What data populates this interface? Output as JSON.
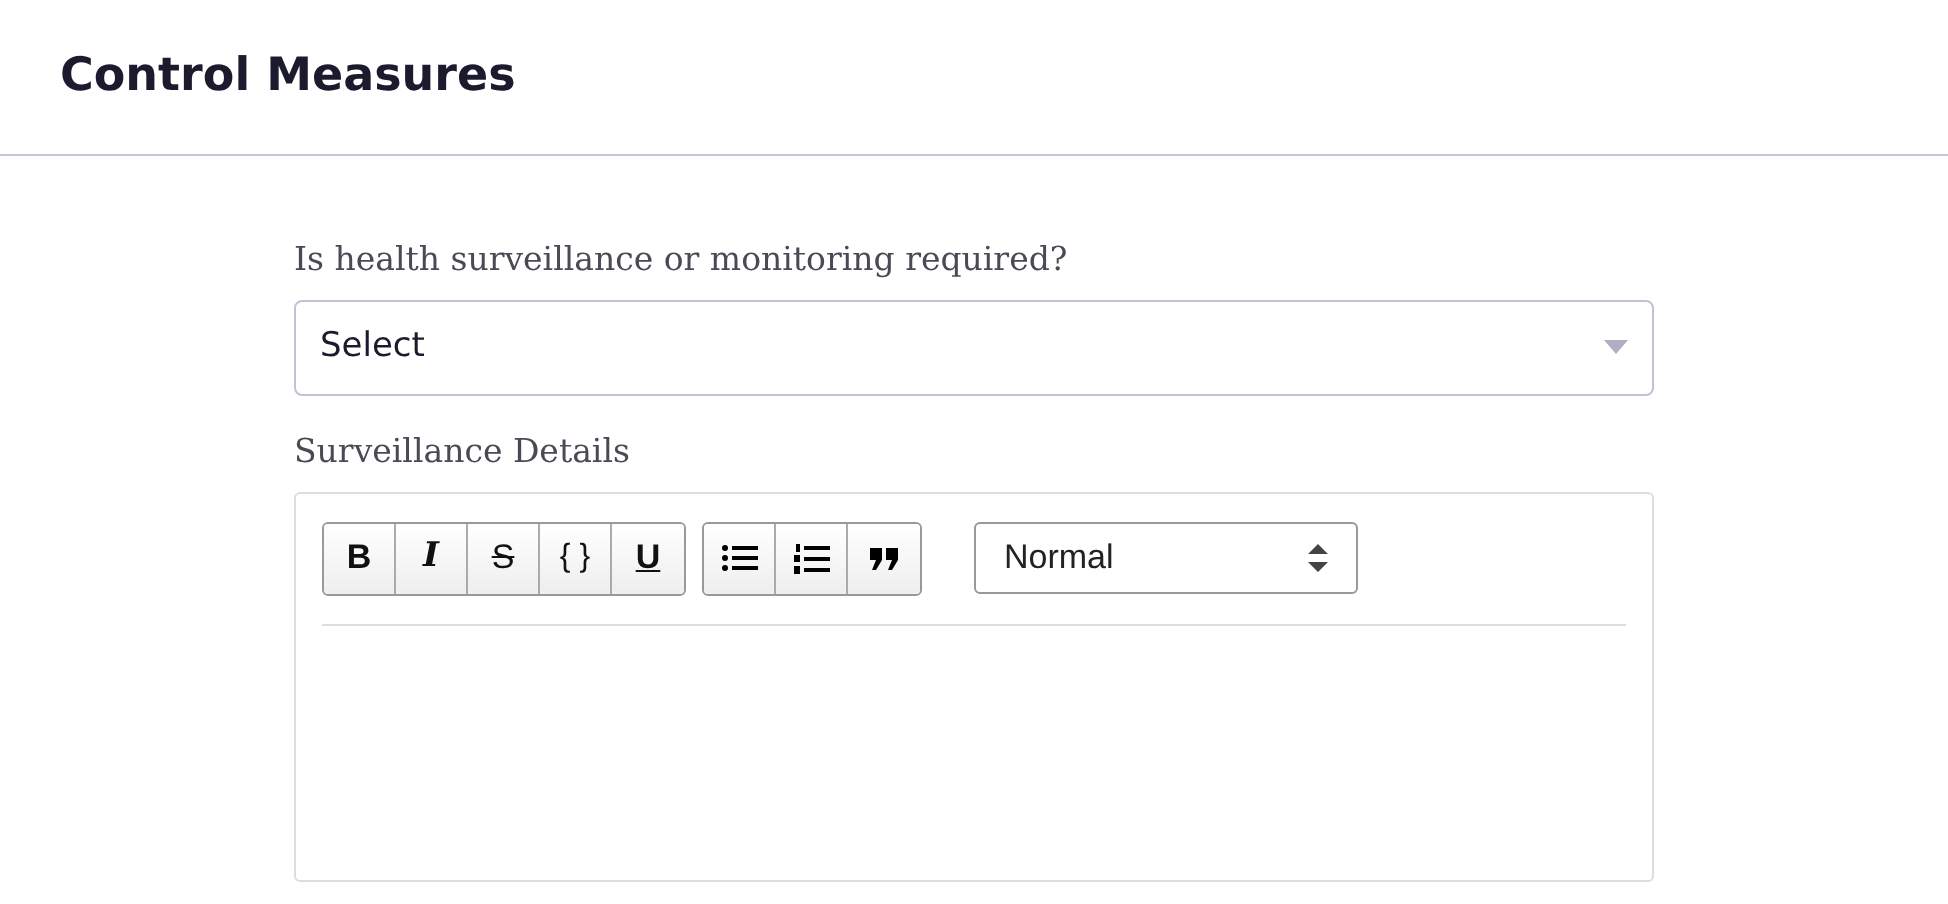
{
  "header": {
    "title": "Control Measures"
  },
  "fields": [
    {
      "kind": "select",
      "label": "Is health surveillance or monitoring required?",
      "value": "Select"
    },
    {
      "kind": "editor",
      "label": "Surveillance Details",
      "toolbar": {
        "groups": [
          [
            {
              "kind": "bold",
              "text": "B"
            },
            {
              "kind": "italic",
              "text": "I"
            },
            {
              "kind": "strike",
              "text": "S"
            },
            {
              "kind": "code",
              "text": "{ }"
            },
            {
              "kind": "underline",
              "text": "U"
            }
          ],
          [
            {
              "kind": "bullet-list"
            },
            {
              "kind": "numbered-list"
            },
            {
              "kind": "quote"
            }
          ]
        ],
        "format": "Normal"
      }
    }
  ]
}
